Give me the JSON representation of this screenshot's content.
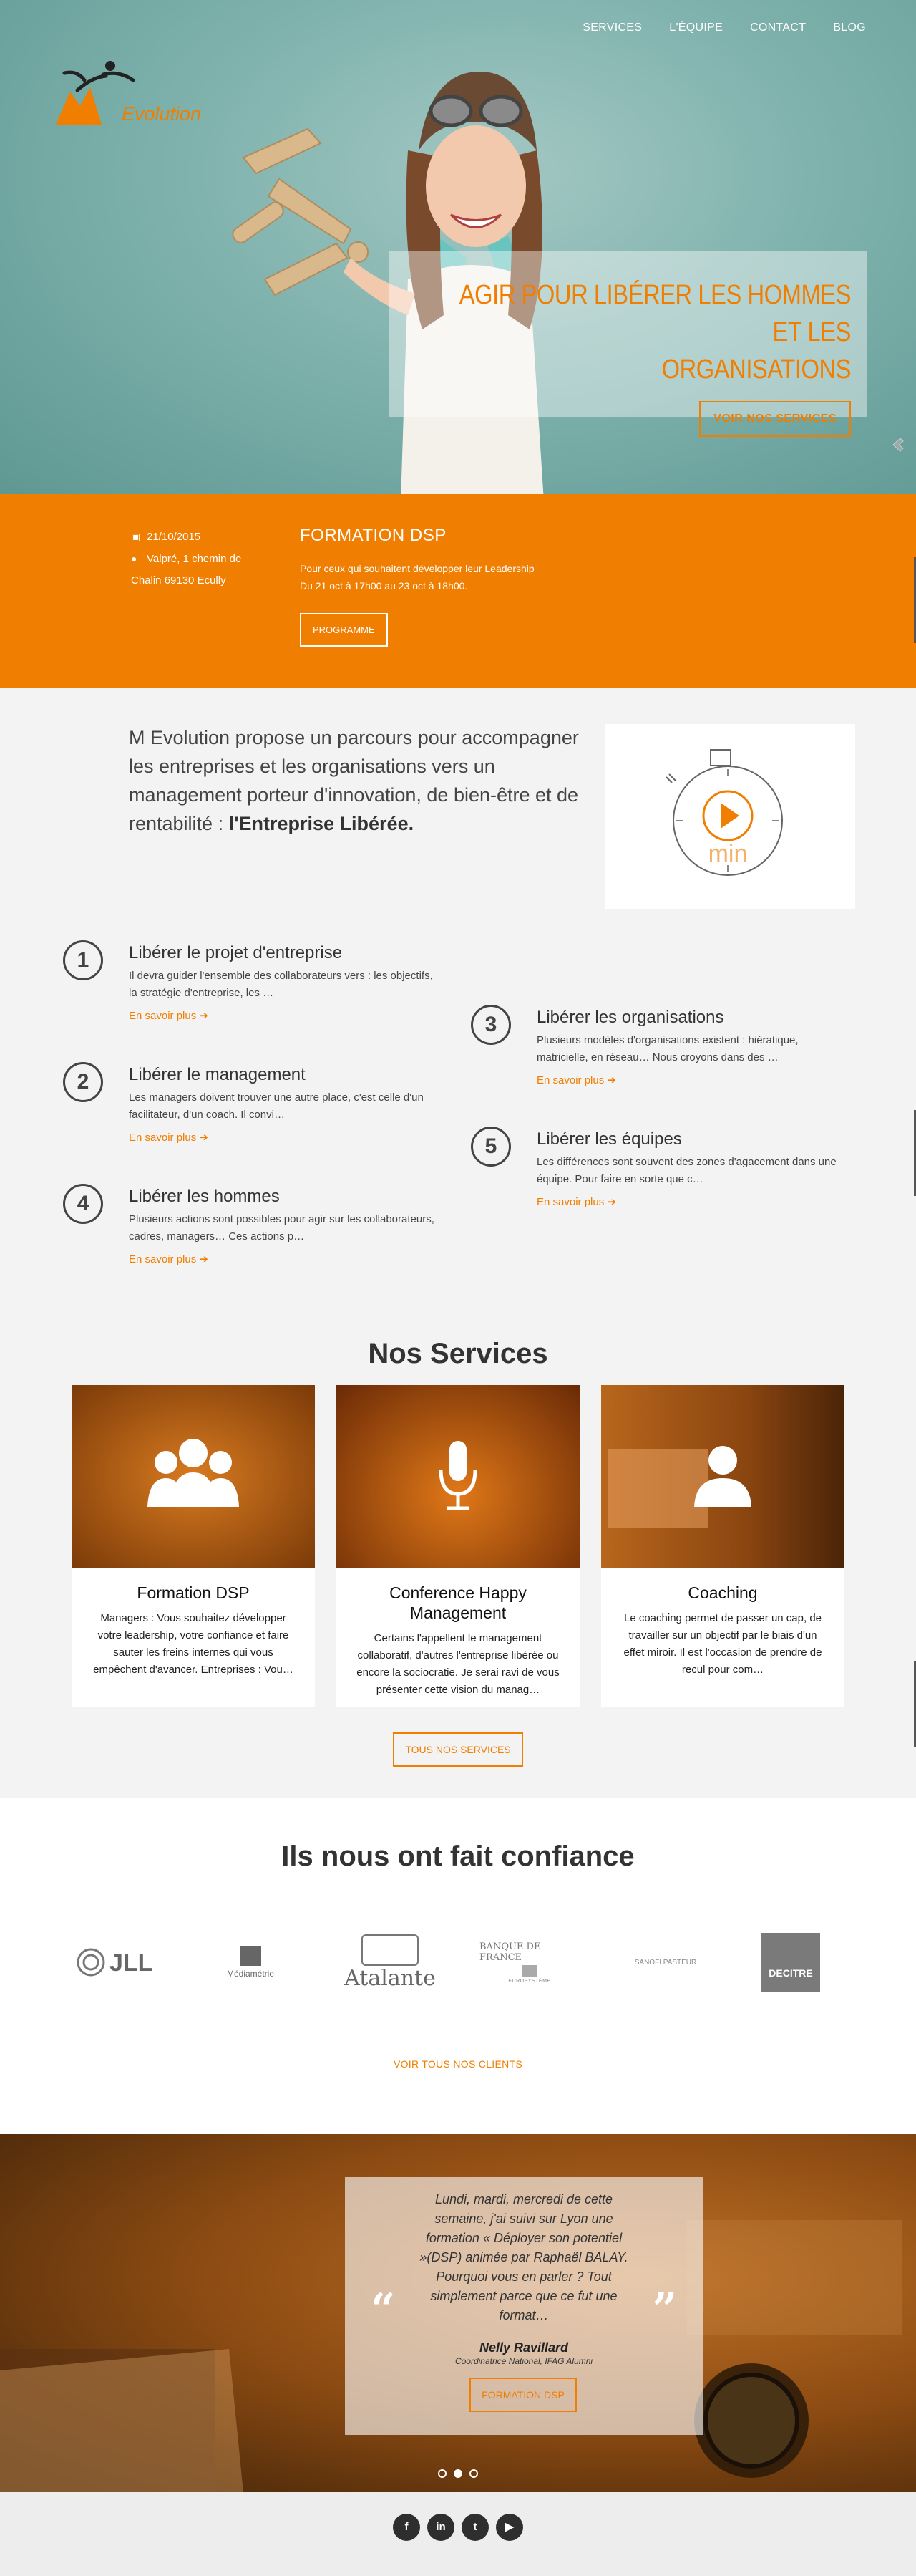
{
  "nav": {
    "items": [
      "SERVICES",
      "L'ÉQUIPE",
      "CONTACT",
      "BLOG"
    ]
  },
  "logo": {
    "prefix": "M",
    "brand": "Evolution"
  },
  "hero": {
    "title_line1": "AGIR POUR LIBÉRER LES HOMMES ET LES",
    "title_line2": "ORGANISATIONS",
    "button": "VOIR NOS SERVICES"
  },
  "event": {
    "date": "21/10/2015",
    "address_line1": "Valpré, 1 chemin de",
    "address_line2": "Chalin 69130 Ecully",
    "title": "FORMATION DSP",
    "desc_line1": "Pour ceux qui souhaitent développer leur Leadership",
    "desc_line2": "Du 21 oct à 17h00 au 23 oct à 18h00.",
    "button": "PROGRAMME"
  },
  "intro": {
    "text": "M Evolution propose un parcours pour accompagner les entreprises et les organisations vers un management porteur d'innovation, de bien-être et de rentabilité : ",
    "bold": "l'Entreprise Libérée.",
    "video_label": "min"
  },
  "steps": [
    {
      "num": "1",
      "title": "Libérer le projet d'entreprise",
      "desc": "Il devra guider l'ensemble des collaborateurs vers : les objectifs, la stratégie d'entreprise, les …",
      "link": "En savoir plus"
    },
    {
      "num": "2",
      "title": "Libérer le management",
      "desc": "Les managers doivent trouver une autre place, c'est celle d'un facilitateur, d'un coach. Il convi…",
      "link": "En savoir plus"
    },
    {
      "num": "4",
      "title": "Libérer les hommes",
      "desc": "Plusieurs actions sont possibles pour agir sur les collaborateurs, cadres, managers… Ces actions p…",
      "link": "En savoir plus"
    },
    {
      "num": "3",
      "title": "Libérer les organisations",
      "desc": "Plusieurs modèles d'organisations existent : hiératique, matricielle, en réseau… Nous croyons dans des …",
      "link": "En savoir plus"
    },
    {
      "num": "5",
      "title": "Libérer les équipes",
      "desc": "Les différences sont souvent des zones d'agacement dans une équipe. Pour faire en sorte que c…",
      "link": "En savoir plus"
    }
  ],
  "services": {
    "title": "Nos Services",
    "cards": [
      {
        "title": "Formation DSP",
        "desc": "Managers : Vous souhaitez développer votre leadership, votre confiance et faire sauter les freins internes qui vous empêchent d'avancer. Entreprises : Vou…",
        "icon": "group-icon"
      },
      {
        "title": "Conference Happy Management",
        "desc": "Certains l'appellent le management collaboratif, d'autres l'entreprise libérée ou encore la sociocratie. Je serai ravi de vous présenter cette vision du manag…",
        "icon": "microphone-icon"
      },
      {
        "title": "Coaching",
        "desc": "Le coaching permet de passer un cap, de travailler sur un objectif par le biais d'un effet miroir. Il est l'occasion de prendre de recul pour com…",
        "icon": "user-icon"
      }
    ],
    "button": "TOUS NOS SERVICES"
  },
  "clients": {
    "title": "Ils nous ont fait confiance",
    "logos": [
      "JLL",
      "Médiamétrie",
      "Atalante",
      "BANQUE DE FRANCE",
      "EUROSYSTÈME",
      "SANOFI PASTEUR",
      "DECITRE"
    ],
    "button": "VOIR TOUS NOS CLIENTS"
  },
  "testimonial": {
    "text": "Lundi, mardi, mercredi de cette semaine, j'ai suivi sur Lyon une formation « Déployer son potentiel »(DSP) animée par Raphaël BALAY. Pourquoi vous en parler ? Tout simplement parce que ce fut une format…",
    "name": "Nelly Ravillard",
    "role": "Coordinatrice National, IFAG Alumni",
    "button": "FORMATION DSP"
  },
  "footer": {
    "socials": [
      {
        "icon": "facebook-icon",
        "glyph": "f"
      },
      {
        "icon": "linkedin-icon",
        "glyph": "in"
      },
      {
        "icon": "twitter-icon",
        "glyph": "t"
      },
      {
        "icon": "youtube-icon",
        "glyph": "▶"
      }
    ]
  },
  "colors": {
    "accent": "#f07e00",
    "hero_bg": "#7fb2ad",
    "section_bg": "#f3f3f3"
  }
}
